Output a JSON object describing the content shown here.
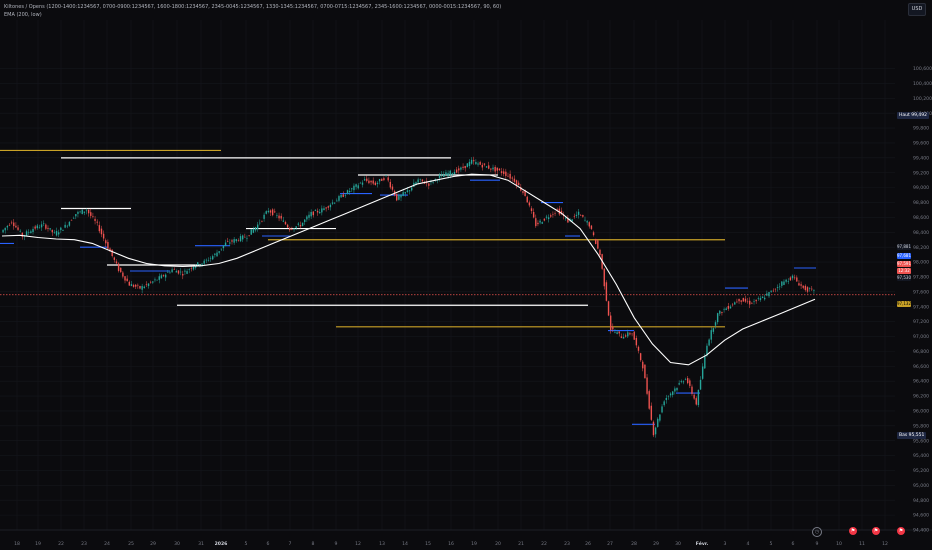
{
  "header": {
    "title": "Kiltones / Opens (1200-1400:1234567, 0700-0900:1234567, 1600-1800:1234567, 2345-0045:1234567, 1330-1345:1234567, 0700-0715:1234567, 2345-1600:1234567, 0000-0015:1234567, 90, 60)",
    "indicator": "EMA (200, low)"
  },
  "currency_button": "USD",
  "chart_data": {
    "type": "line",
    "title": "",
    "xlabel": "",
    "ylabel": "",
    "ylim": [
      94400,
      101400
    ],
    "y_ticks": [
      94400,
      94600,
      94800,
      95000,
      95200,
      95400,
      95600,
      95800,
      96000,
      96200,
      96400,
      96600,
      96800,
      97000,
      97200,
      97400,
      97600,
      97800,
      98000,
      98200,
      98400,
      98600,
      98800,
      99000,
      99200,
      99400,
      99600,
      99800,
      100000,
      100200,
      100400,
      100600
    ],
    "x_ticks": [
      "18",
      "19",
      "22",
      "23",
      "24",
      "25",
      "29",
      "30",
      "31",
      "2026",
      "5",
      "6",
      "7",
      "8",
      "9",
      "12",
      "13",
      "14",
      "15",
      "16",
      "19",
      "20",
      "21",
      "22",
      "23",
      "26",
      "27",
      "28",
      "29",
      "30",
      "Févr.",
      "3",
      "4",
      "5",
      "6",
      "9",
      "10",
      "11",
      "12"
    ],
    "series": [
      {
        "kind": "price",
        "values": [
          98400,
          98550,
          98350,
          98450,
          98500,
          98380,
          98480,
          98650,
          98700,
          98500,
          98200,
          97900,
          97700,
          97650,
          97720,
          97800,
          97900,
          97850,
          97950,
          98000,
          98100,
          98250,
          98300,
          98350,
          98500,
          98700,
          98600,
          98450,
          98500,
          98650,
          98700,
          98800,
          98900,
          99000,
          99100,
          99050,
          99150,
          98850,
          98950,
          99100,
          99050,
          99150,
          99200,
          99250,
          99350,
          99300,
          99250,
          99200,
          99100,
          98900,
          98500,
          98600,
          98700,
          98550,
          98650,
          98500,
          98100,
          97100,
          97000,
          97050,
          96600,
          95700,
          96150,
          96300,
          96450,
          96100,
          96900,
          97300,
          97400,
          97500,
          97450,
          97500,
          97600,
          97720,
          97800,
          97650,
          97600
        ]
      },
      {
        "kind": "ema",
        "name": "EMA (200, low)",
        "values": [
          98350,
          98360,
          98330,
          98310,
          98300,
          98250,
          98150,
          98050,
          97980,
          97950,
          97940,
          97950,
          97980,
          98050,
          98150,
          98250,
          98350,
          98450,
          98550,
          98650,
          98750,
          98850,
          98950,
          99050,
          99100,
          99150,
          99180,
          99170,
          99100,
          98950,
          98800,
          98650,
          98450,
          98100,
          97700,
          97250,
          96900,
          96650,
          96620,
          96750,
          96950,
          97100,
          97200,
          97300,
          97400,
          97500
        ]
      }
    ],
    "horizontal_levels": [
      {
        "value": 99500,
        "color": "#c9a227",
        "x_from": "18",
        "x_to": "2026"
      },
      {
        "value": 98300,
        "color": "#c9a227",
        "x_from": "6",
        "x_to": "3"
      },
      {
        "value": 97130,
        "color": "#c9a227",
        "x_from": "3",
        "x_to": "9"
      },
      {
        "value": 99400,
        "color": "#ffffff",
        "x_from": "16",
        "x_to": "22"
      },
      {
        "value": 99170,
        "color": "#ffffff",
        "x_from": "12",
        "x_to": "20"
      },
      {
        "value": 98720,
        "color": "#ffffff",
        "x_from": "22",
        "x_to": "25"
      },
      {
        "value": 98450,
        "color": "#ffffff",
        "x_from": "5",
        "x_to": "9"
      },
      {
        "value": 97960,
        "color": "#ffffff",
        "x_from": "24",
        "x_to": "31"
      },
      {
        "value": 97420,
        "color": "#ffffff",
        "x_from": "26",
        "x_to": "30"
      }
    ],
    "current_price": 97561,
    "price_tags": [
      {
        "text": "97,881",
        "bg": "#131722",
        "fg": "#d1d4dc"
      },
      {
        "text": "97,681",
        "bg": "#2962ff",
        "fg": "#ffffff"
      },
      {
        "text": "97,591",
        "bg": "#ef5350",
        "fg": "#ffffff"
      },
      {
        "text": "12:32",
        "bg": "#ef5350",
        "fg": "#ffffff"
      },
      {
        "text": "97,530",
        "bg": "#131722",
        "fg": "#d1d4dc"
      },
      {
        "text": "97,132",
        "bg": "#c9a227",
        "fg": "#000000"
      }
    ],
    "level_labels": [
      {
        "name": "Haut",
        "value": "99,492"
      },
      {
        "name": "Bas",
        "value": "95,551"
      }
    ]
  },
  "colors": {
    "background": "#0b0b0e",
    "grid": "#15171c",
    "up": "#26a69a",
    "down": "#ef5350",
    "ema": "#ffffff",
    "session_blue": "#2962ff",
    "level_gold": "#c9a227"
  }
}
